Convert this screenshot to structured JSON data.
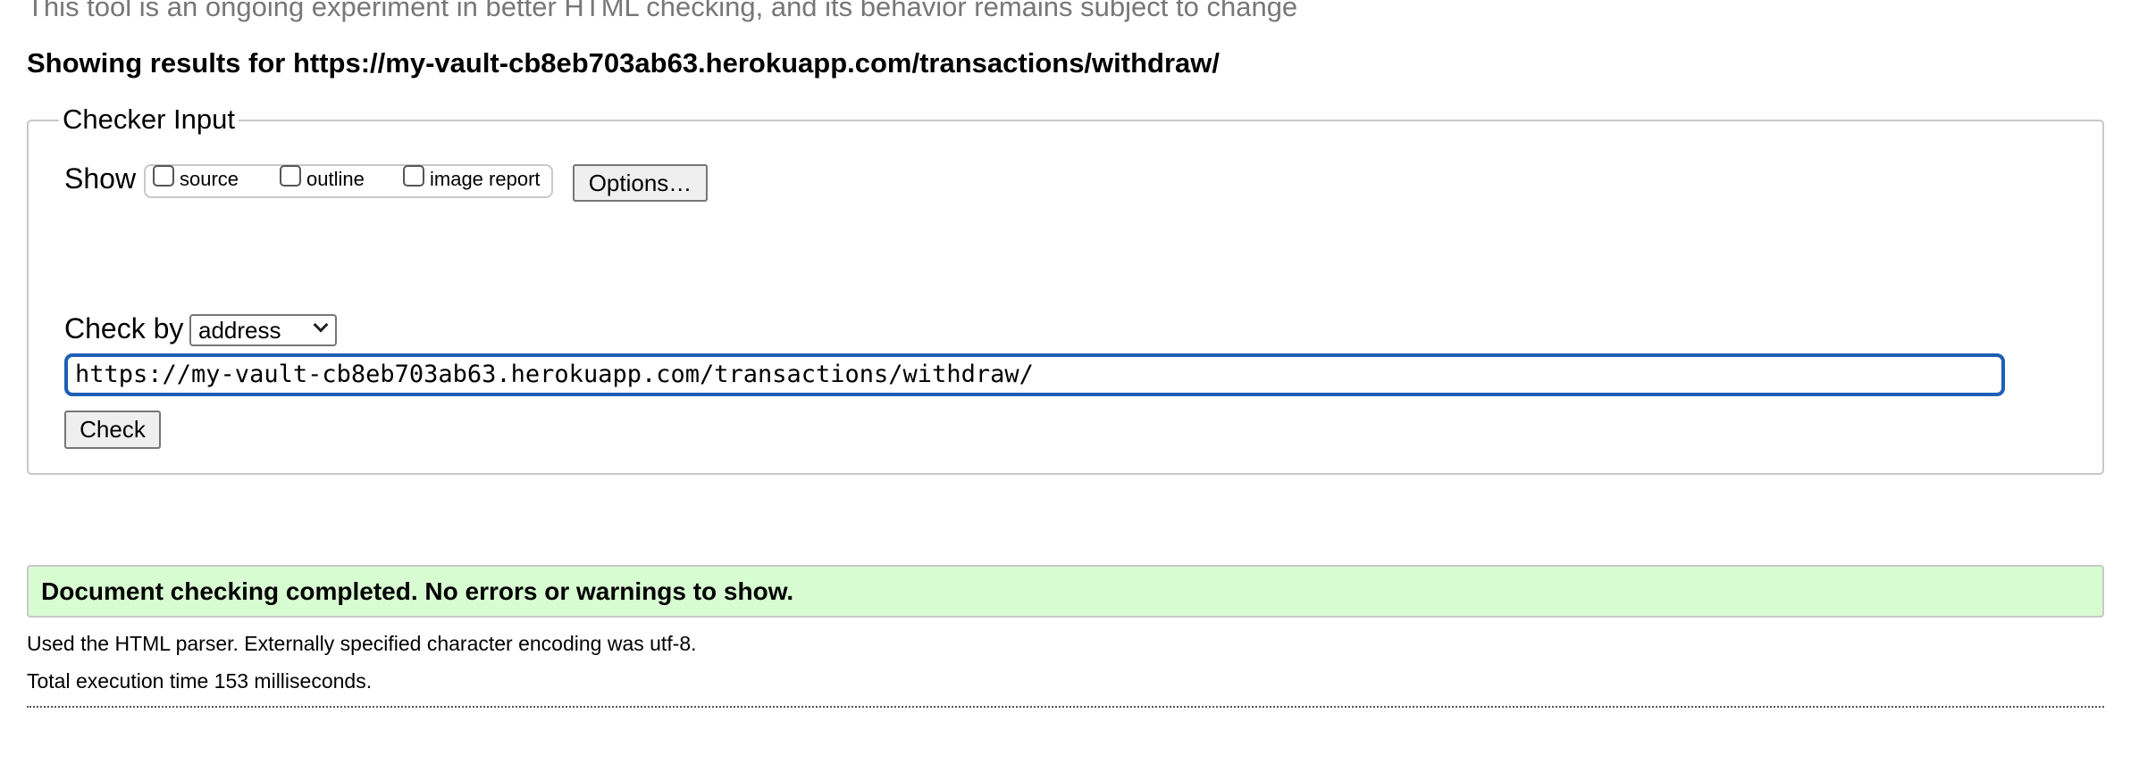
{
  "intro_text": "This tool is an ongoing experiment in better HTML checking, and its behavior remains subject to change",
  "results_heading": "Showing results for https://my-vault-cb8eb703ab63.herokuapp.com/transactions/withdraw/",
  "checker": {
    "legend": "Checker Input",
    "show_label": "Show",
    "show_options": [
      {
        "label": "source",
        "checked": false
      },
      {
        "label": "outline",
        "checked": false
      },
      {
        "label": "image report",
        "checked": false
      }
    ],
    "options_button": "Options…",
    "check_by_label": "Check by",
    "check_by_value": "address",
    "url_value": "https://my-vault-cb8eb703ab63.herokuapp.com/transactions/withdraw/",
    "check_button": "Check"
  },
  "result": {
    "success_message": "Document checking completed. No errors or warnings to show.",
    "parser_info": "Used the HTML parser. Externally specified character encoding was utf-8.",
    "execution_time": "Total execution time 153 milliseconds."
  },
  "colors": {
    "success_bg": "#d8fcd2",
    "focus_border": "#1e5fb4",
    "muted_text": "#777777"
  }
}
